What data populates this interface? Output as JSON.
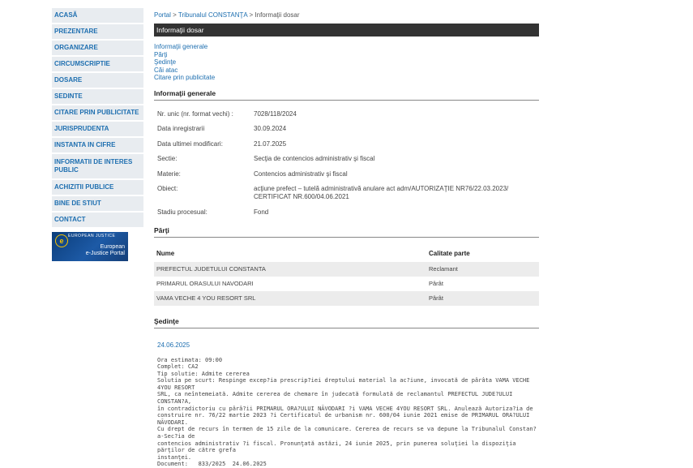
{
  "sidebar": {
    "items": [
      {
        "label": "ACASĂ"
      },
      {
        "label": "PREZENTARE"
      },
      {
        "label": "ORGANIZARE"
      },
      {
        "label": "CIRCUMSCRIPTIE"
      },
      {
        "label": "DOSARE"
      },
      {
        "label": "SEDINTE"
      },
      {
        "label": "CITARE PRIN PUBLICITATE"
      },
      {
        "label": "JURISPRUDENTA"
      },
      {
        "label": "INSTANTA IN CIFRE"
      },
      {
        "label": "INFORMATII DE INTERES PUBLIC"
      },
      {
        "label": "ACHIZITII PUBLICE"
      },
      {
        "label": "BINE DE STIUT"
      },
      {
        "label": "CONTACT"
      }
    ],
    "ejustice": {
      "top": "EUROPEAN JUSTICE",
      "bottom1": "European",
      "bottom2": "e-Justice Portal",
      "logo": "e"
    }
  },
  "breadcrumb": {
    "portal": "Portal",
    "sep": ">",
    "court": "Tribunalul CONSTANŢA",
    "current": "Informaţii dosar"
  },
  "title": "Informaţii dosar",
  "quicklinks": [
    "Informaţii generale",
    "Părţi",
    "Şedinţe",
    "Căi atac",
    "Citare prin publicitate"
  ],
  "info": {
    "heading": "Informaţii generale",
    "rows": [
      {
        "label": "Nr. unic (nr. format vechi) :",
        "value": "7028/118/2024"
      },
      {
        "label": "Data inregistrarii",
        "value": "30.09.2024"
      },
      {
        "label": "Data ultimei modificari:",
        "value": "21.07.2025"
      },
      {
        "label": "Sectie:",
        "value": "Secţia de contencios administrativ şi fiscal"
      },
      {
        "label": "Materie:",
        "value": "Contencios administrativ şi fiscal"
      },
      {
        "label": "Obiect:",
        "value": "acţiune prefect – tutelă administrativă anulare act adm/AUTORIZAŢIE NR76/22.03.2023/ CERTIFICAT NR.600/04.06.2021"
      },
      {
        "label": "Stadiu procesual:",
        "value": "Fond"
      }
    ]
  },
  "parti": {
    "heading": "Părţi",
    "col_name": "Nume",
    "col_role": "Calitate parte",
    "rows": [
      {
        "name": "PREFECTUL JUDETULUI CONSTANTA",
        "role": "Reclamant"
      },
      {
        "name": "PRIMARUL ORASULUI NAVODARI",
        "role": "Pârât"
      },
      {
        "name": "VAMA VECHE 4 YOU RESORT SRL",
        "role": "Pârât"
      }
    ]
  },
  "sedinte": {
    "heading": "Şedinţe",
    "date": "24.06.2025",
    "lines": [
      "Ora estimata: 09:00",
      "Complet: CA2",
      "Tip solutie: Admite cererea",
      "Solutia pe scurt: Respinge excep?ia prescrip?iei dreptului material la ac?iune, invocată de pârâta VAMA VECHE 4YOU RESORT",
      "SRL, ca neîntemeiată. Admite cererea de chemare în judecată formulată de reclamantul PREFECTUL JUDE?ULUI CONSTAN?A,",
      "în contradictoriu cu pârâ?ii PRIMARUL ORA?ULUI NĂVODARI ?i VAMA VECHE 4YOU RESORT SRL. Anulează Autoriza?ia de",
      "construire nr. 76/22 martie 2023 ?i Certificatul de urbanism nr. 600/04 iunie 2021 emise de PRIMARUL ORA?ULUI NĂVODARI.",
      "Cu drept de recurs în termen de 15 zile de la comunicare. Cererea de recurs se va depune la Tribunalul Constan?a-Sec?ia de",
      "contencios administrativ ?i fiscal. Pronunţată astăzi, 24 iunie 2025, prin punerea soluţiei la dispoziţia părţilor de către grefa",
      "instanţei.",
      "Document:   833/2025  24.06.2025"
    ]
  }
}
